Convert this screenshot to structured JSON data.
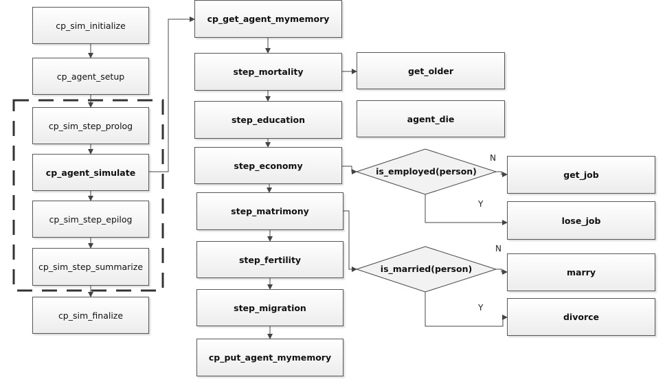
{
  "left_column": [
    "cp_sim_initialize",
    "cp_agent_setup",
    "cp_sim_step_prolog",
    "cp_agent_simulate",
    "cp_sim_step_epilog",
    "cp_sim_step_summarize",
    "cp_sim_finalize"
  ],
  "middle_column": [
    "cp_get_agent_mymemory",
    "step_mortality",
    "step_education",
    "step_economy",
    "step_matrimony",
    "step_fertility",
    "step_migration",
    "cp_put_agent_mymemory"
  ],
  "mortality_branch": [
    "get_older",
    "agent_die"
  ],
  "decisions": {
    "employed": {
      "label": "is_employed(person)",
      "no": "N",
      "yes": "Y",
      "no_target": "get_job",
      "yes_target": "lose_job"
    },
    "married": {
      "label": "is_married(person)",
      "no": "N",
      "yes": "Y",
      "no_target": "marry",
      "yes_target": "divorce"
    }
  }
}
